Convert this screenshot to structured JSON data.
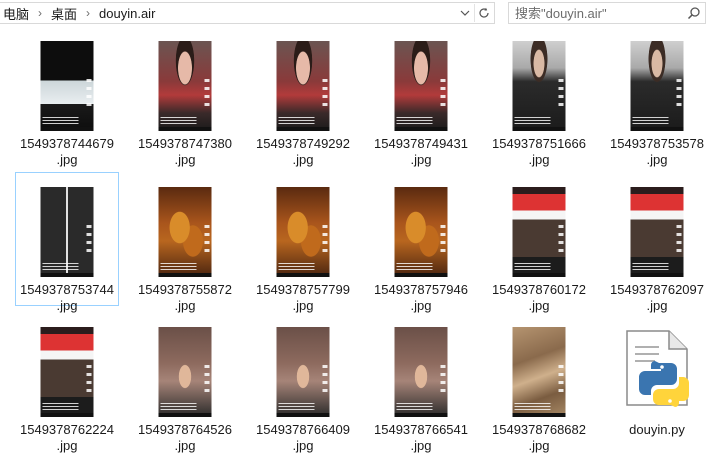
{
  "addressbar": {
    "crumbs": [
      "电脑",
      "桌面",
      "douyin.air"
    ]
  },
  "search": {
    "placeholder": "搜索\"douyin.air\""
  },
  "files": [
    {
      "name": "1549378744679\n.jpg",
      "thumb": "t-dark"
    },
    {
      "name": "1549378747380\n.jpg",
      "thumb": "t-red"
    },
    {
      "name": "1549378749292\n.jpg",
      "thumb": "t-red"
    },
    {
      "name": "1549378749431\n.jpg",
      "thumb": "t-red"
    },
    {
      "name": "1549378751666\n.jpg",
      "thumb": "t-blk"
    },
    {
      "name": "1549378753578\n.jpg",
      "thumb": "t-blk"
    },
    {
      "name": "1549378753744\n.jpg",
      "thumb": "t-two",
      "selected": true
    },
    {
      "name": "1549378755872\n.jpg",
      "thumb": "t-food"
    },
    {
      "name": "1549378757799\n.jpg",
      "thumb": "t-food"
    },
    {
      "name": "1549378757946\n.jpg",
      "thumb": "t-food"
    },
    {
      "name": "1549378760172\n.jpg",
      "thumb": "t-show"
    },
    {
      "name": "1549378762097\n.jpg",
      "thumb": "t-show"
    },
    {
      "name": "1549378762224\n.jpg",
      "thumb": "t-show"
    },
    {
      "name": "1549378764526\n.jpg",
      "thumb": "t-hair"
    },
    {
      "name": "1549378766409\n.jpg",
      "thumb": "t-hair"
    },
    {
      "name": "1549378766541\n.jpg",
      "thumb": "t-hair"
    },
    {
      "name": "1549378768682\n.jpg",
      "thumb": "t-land"
    },
    {
      "name": "douyin.py",
      "icon": "python-file-icon"
    }
  ],
  "colors": {
    "selection_border": "#99d1ff",
    "python_blue": "#3a75b0",
    "python_yellow": "#ffd43b"
  }
}
